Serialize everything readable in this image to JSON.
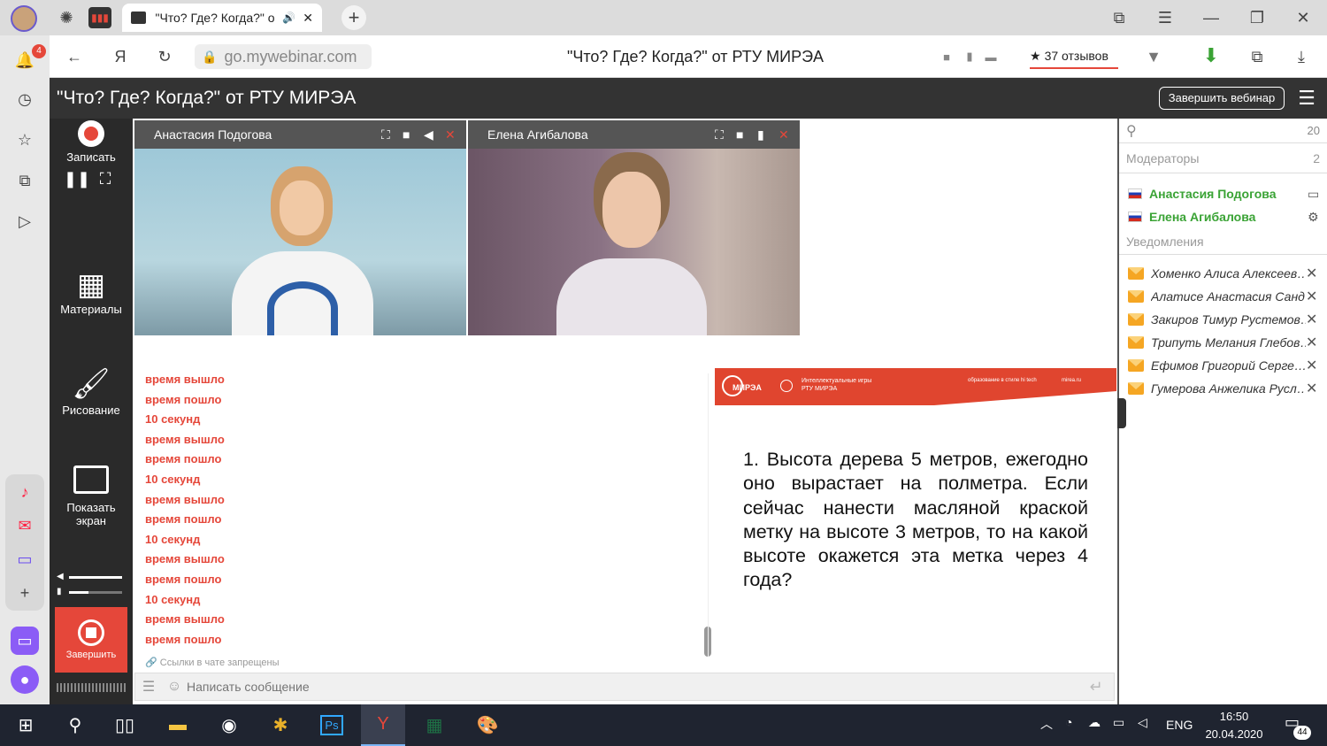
{
  "browser": {
    "tab_title": "\"Что? Где? Когда?\" о",
    "address": "go.mywebinar.com",
    "page_title": "\"Что? Где? Когда?\" от РТУ МИРЭА",
    "reviews": "37 отзывов",
    "notif_badge": "4"
  },
  "webinar": {
    "title": "\"Что? Где? Когда?\" от РТУ МИРЭА",
    "end_webinar": "Завершить вебинар"
  },
  "toolbar": {
    "record": "Записать",
    "materials": "Материалы",
    "drawing": "Рисование",
    "share_screen_1": "Показать",
    "share_screen_2": "экран",
    "finish": "Завершить"
  },
  "videos": [
    {
      "name": "Анастасия Подогова"
    },
    {
      "name": "Елена Агибалова"
    }
  ],
  "chat": {
    "lines": [
      "время вышло",
      "время пошло",
      "10 секунд",
      "время вышло",
      "время пошло",
      "10 секунд",
      "время вышло",
      "время пошло",
      "10 секунд",
      "время вышло",
      "время пошло",
      "10 секунд",
      "время вышло",
      "время пошло"
    ],
    "links_notice": "Ссылки в чате запрещены",
    "input_placeholder": "Написать сообщение"
  },
  "slide": {
    "header_brand": "МИРЭА",
    "header_title_1": "Интеллектуальные игры",
    "header_title_2": "РТУ МИРЭА",
    "header_tag": "образование в стиле hi tech",
    "header_site": "mirea.ru",
    "question": "1. Высота дерева 5 метров, ежегодно оно вырастает на полметра. Если сейчас нанести масляной краской метку на высоте 3 метров, то на какой высоте окажется эта метка через 4 года?"
  },
  "participants": {
    "count": "20",
    "moderators_label": "Модераторы",
    "moderators_count": "2",
    "moderators": [
      "Анастасия Подогова",
      "Елена Агибалова"
    ],
    "notifications_label": "Уведомления",
    "notifications": [
      "Хоменко Алиса Алексеев…",
      "Алатисе Анастасия Санд…",
      "Закиров Тимур Рустемов…",
      "Трипуть Мелания Глебов…",
      "Ефимов Григорий Серге…",
      "Гумерова Анжелика Русл…"
    ]
  },
  "taskbar": {
    "lang": "ENG",
    "time": "16:50",
    "date": "20.04.2020",
    "notif_count": "44"
  },
  "colors": {
    "accent": "#e5473a",
    "moderator_green": "#3aa335",
    "dark": "#333333"
  }
}
